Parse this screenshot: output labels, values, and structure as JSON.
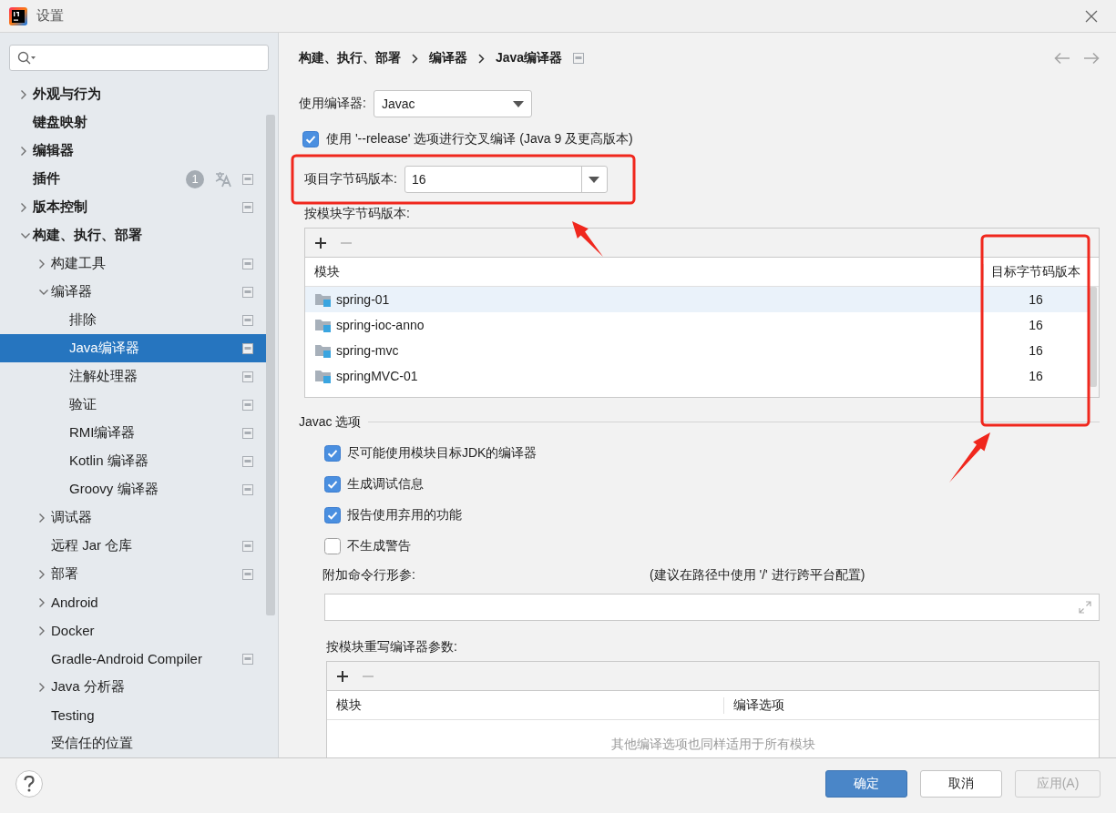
{
  "window": {
    "title": "设置"
  },
  "sidebar": {
    "items": [
      {
        "label": "外观与行为",
        "expanded": false,
        "selected": false,
        "scope_icon": false
      },
      {
        "label": "键盘映射",
        "selected": false,
        "scope_icon": false
      },
      {
        "label": "编辑器",
        "expanded": false,
        "selected": false,
        "scope_icon": false
      },
      {
        "label": "插件",
        "selected": false,
        "scope_icon": true,
        "badge": "1",
        "translate_icon": true
      },
      {
        "label": "版本控制",
        "expanded": false,
        "selected": false,
        "scope_icon": true
      },
      {
        "label": "构建、执行、部署",
        "expanded": true,
        "selected": false,
        "scope_icon": false,
        "children": [
          {
            "label": "构建工具",
            "expanded": false,
            "selected": false,
            "scope_icon": true
          },
          {
            "label": "编译器",
            "expanded": true,
            "selected": false,
            "scope_icon": true,
            "children": [
              {
                "label": "排除",
                "selected": false,
                "scope_icon": true
              },
              {
                "label": "Java编译器",
                "selected": true,
                "scope_icon": true
              },
              {
                "label": "注解处理器",
                "selected": false,
                "scope_icon": true
              },
              {
                "label": "验证",
                "selected": false,
                "scope_icon": true
              },
              {
                "label": "RMI编译器",
                "selected": false,
                "scope_icon": true
              },
              {
                "label": "Kotlin 编译器",
                "selected": false,
                "scope_icon": true
              },
              {
                "label": "Groovy 编译器",
                "selected": false,
                "scope_icon": true
              }
            ]
          },
          {
            "label": "调试器",
            "expanded": false,
            "selected": false,
            "scope_icon": false
          },
          {
            "label": "远程 Jar 仓库",
            "selected": false,
            "scope_icon": true
          },
          {
            "label": "部署",
            "expanded": false,
            "selected": false,
            "scope_icon": true
          },
          {
            "label": "Android",
            "expanded": false,
            "selected": false,
            "scope_icon": false
          },
          {
            "label": "Docker",
            "expanded": false,
            "selected": false,
            "scope_icon": false
          },
          {
            "label": "Gradle-Android Compiler",
            "selected": false,
            "scope_icon": true
          },
          {
            "label": "Java 分析器",
            "expanded": false,
            "selected": false,
            "scope_icon": false
          },
          {
            "label": "Testing",
            "selected": false,
            "scope_icon": false
          },
          {
            "label": "受信任的位置",
            "selected": false,
            "scope_icon": false
          }
        ]
      }
    ]
  },
  "breadcrumb": [
    "构建、执行、部署",
    "编译器",
    "Java编译器"
  ],
  "compiler": {
    "label": "使用编译器:",
    "value": "Javac"
  },
  "release_option": {
    "label": "使用 '--release' 选项进行交叉编译 (Java 9 及更高版本)",
    "checked": true
  },
  "project_bytecode": {
    "label": "项目字节码版本:",
    "value": "16"
  },
  "module_bytecode": {
    "label": "按模块字节码版本:",
    "columns": [
      "模块",
      "目标字节码版本"
    ],
    "rows": [
      {
        "module": "spring-01",
        "version": "16",
        "selected": true
      },
      {
        "module": "spring-ioc-anno",
        "version": "16",
        "selected": false
      },
      {
        "module": "spring-mvc",
        "version": "16",
        "selected": false
      },
      {
        "module": "springMVC-01",
        "version": "16",
        "selected": false
      }
    ]
  },
  "javac": {
    "title": "Javac 选项",
    "options": [
      {
        "label": "尽可能使用模块目标JDK的编译器",
        "checked": true
      },
      {
        "label": "生成调试信息",
        "checked": true
      },
      {
        "label": "报告使用弃用的功能",
        "checked": true
      },
      {
        "label": "不生成警告",
        "checked": false
      }
    ],
    "args": {
      "label": "附加命令行形参:",
      "hint": "(建议在路径中使用 '/' 进行跨平台配置)"
    }
  },
  "override": {
    "label": "按模块重写编译器参数:",
    "columns": [
      "模块",
      "编译选项"
    ],
    "empty_text": "其他编译选项也同样适用于所有模块"
  },
  "buttons": [
    {
      "label": "确定",
      "kind": "primary",
      "disabled": false
    },
    {
      "label": "取消",
      "kind": "normal",
      "disabled": false
    },
    {
      "label": "应用(A)",
      "kind": "normal",
      "disabled": true
    }
  ]
}
